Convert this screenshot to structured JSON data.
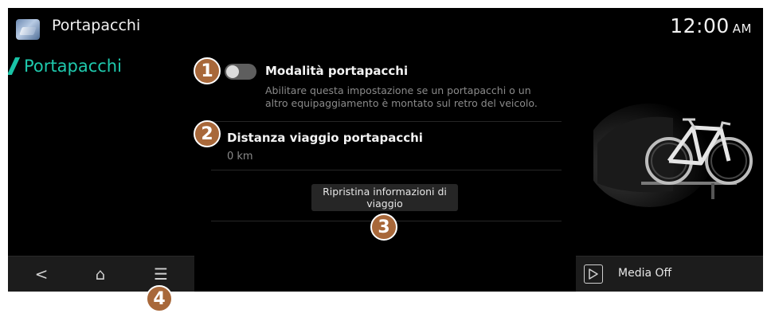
{
  "header": {
    "app_icon": "rack-photo-icon",
    "title": "Portapacchi",
    "clock_time": "12:00",
    "clock_ampm": "AM"
  },
  "sidebar": {
    "items": [
      {
        "label": "Portapacchi",
        "active": true
      }
    ]
  },
  "settings": {
    "rack_mode": {
      "title": "Modalità portapacchi",
      "description_line1": "Abilitare questa impostazione se un portapacchi o un",
      "description_line2": "altro equipaggiamento è montato sul retro del veicolo.",
      "enabled": false
    },
    "trip_distance": {
      "title": "Distanza viaggio portapacchi",
      "value": "0 km"
    },
    "reset_button": {
      "line1": "Ripristina informazioni di",
      "line2": "viaggio"
    }
  },
  "badges": {
    "b1": "1",
    "b2": "2",
    "b3": "3",
    "b4": "4"
  },
  "navbar": {
    "back_icon": "back-icon",
    "home_icon": "home-icon",
    "menu_icon": "menu-icon",
    "back_glyph": "<",
    "home_glyph": "⌂",
    "menu_glyph": "☰"
  },
  "media": {
    "icon": "play-icon",
    "label": "Media Off"
  },
  "colors": {
    "accent": "#1fc9ad",
    "badge": "#a8683a",
    "background": "#000000"
  }
}
